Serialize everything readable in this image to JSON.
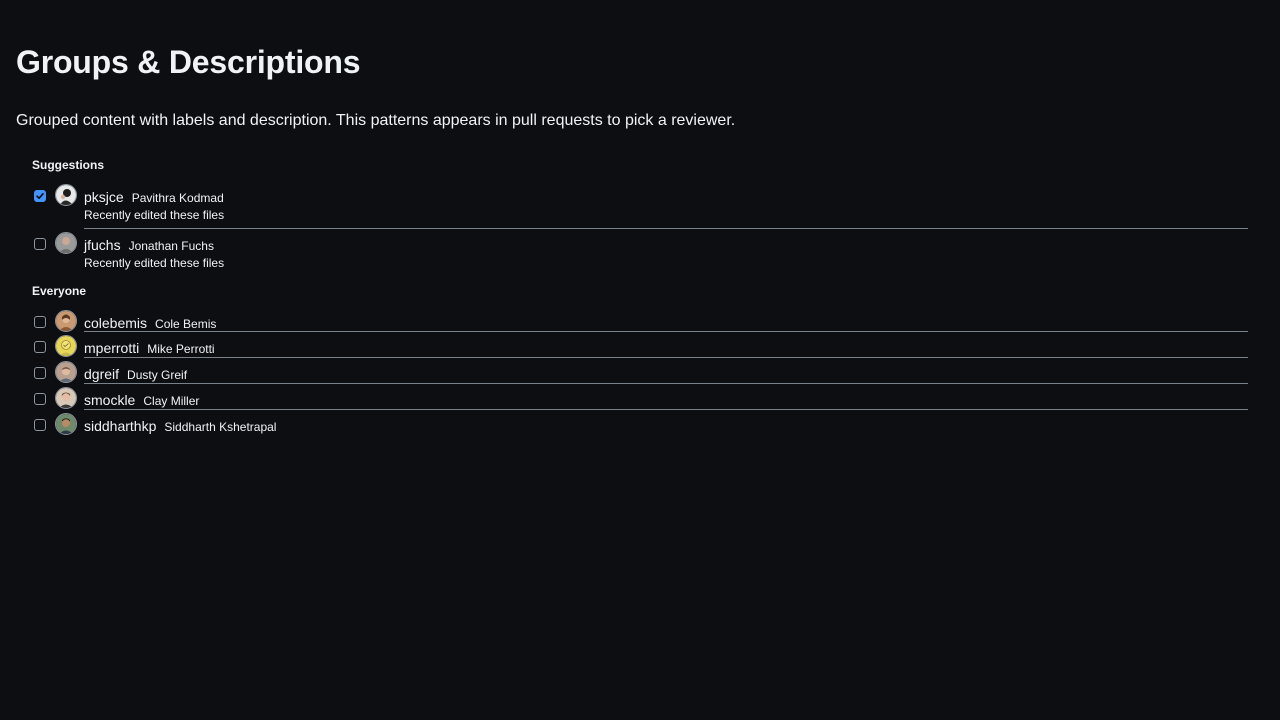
{
  "page": {
    "title": "Groups & Descriptions",
    "description": "Grouped content with labels and description. This patterns appears in pull requests to pick a reviewer."
  },
  "groups": {
    "suggestions": {
      "label": "Suggestions",
      "items": [
        {
          "login": "pksjce",
          "name": "Pavithra Kodmad",
          "description": "Recently edited these files",
          "checked": true
        },
        {
          "login": "jfuchs",
          "name": "Jonathan Fuchs",
          "description": "Recently edited these files",
          "checked": false
        }
      ]
    },
    "everyone": {
      "label": "Everyone",
      "items": [
        {
          "login": "colebemis",
          "name": "Cole Bemis",
          "checked": false
        },
        {
          "login": "mperrotti",
          "name": "Mike Perrotti",
          "checked": false
        },
        {
          "login": "dgreif",
          "name": "Dusty Greif",
          "checked": false
        },
        {
          "login": "smockle",
          "name": "Clay Miller",
          "checked": false
        },
        {
          "login": "siddharthkp",
          "name": "Siddharth Kshetrapal",
          "checked": false
        }
      ]
    }
  },
  "colors": {
    "background": "#0d0e12",
    "text": "#f0f3f6",
    "accent": "#4493f8",
    "border": "#8d96a0"
  }
}
